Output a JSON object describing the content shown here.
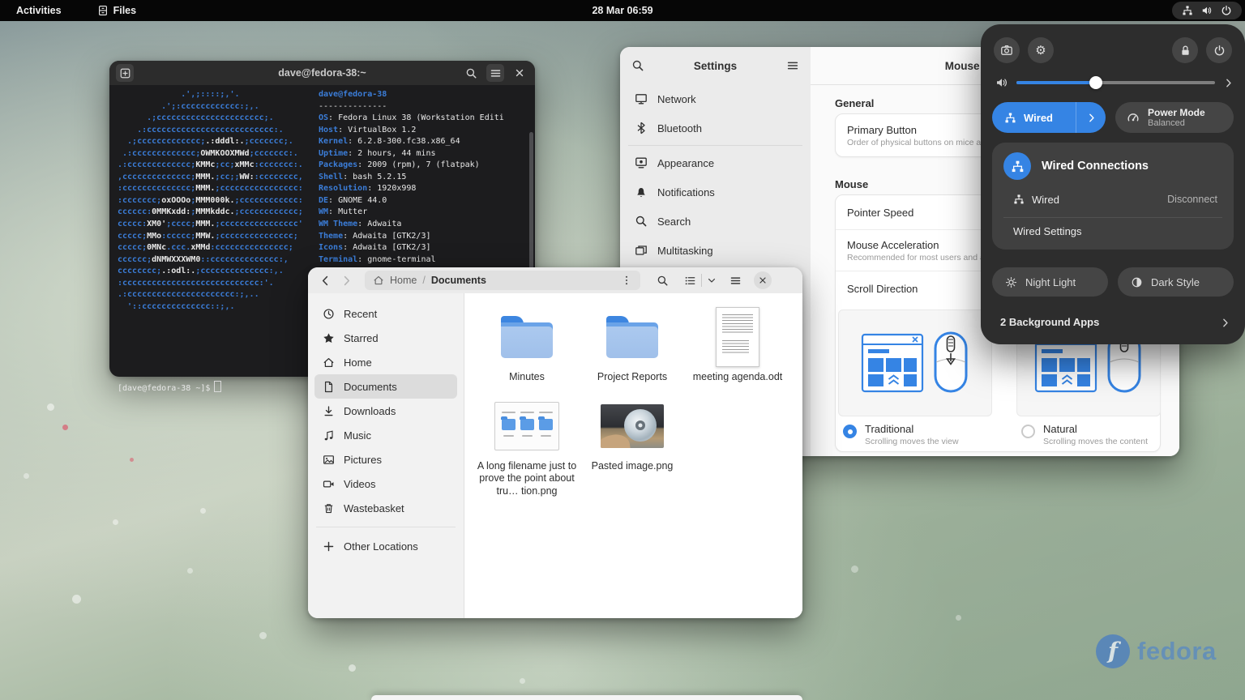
{
  "topbar": {
    "activities_label": "Activities",
    "app_name": "Files",
    "clock": "28 Mar 06:59"
  },
  "terminal": {
    "title": "dave@fedora-38:~",
    "user_host": "dave@fedora-38",
    "separator": "--------------",
    "prompt": "[dave@fedora-38 ~]$",
    "ascii_art": [
      [
        [
          "b",
          "             .',;::::;,'."
        ]
      ],
      [
        [
          "b",
          "         .';:cccccccccccc:;,."
        ]
      ],
      [
        [
          "b",
          "      .;cccccccccccccccccccccc;."
        ]
      ],
      [
        [
          "b",
          "    .:cccccccccccccccccccccccccc:."
        ]
      ],
      [
        [
          "b",
          "  .;ccccccccccccc;"
        ],
        [
          "w",
          ".:dddl:."
        ],
        [
          "b",
          ";ccccccc;."
        ]
      ],
      [
        [
          "b",
          " .:ccccccccccccc;"
        ],
        [
          "w",
          "OWMKOOXMWd"
        ],
        [
          "b",
          ";ccccccc:."
        ]
      ],
      [
        [
          "b",
          ".:ccccccccccccc;"
        ],
        [
          "w",
          "KMMc"
        ],
        [
          "b",
          ";cc;"
        ],
        [
          "w",
          "xMMc"
        ],
        [
          "b",
          ":ccccccc:."
        ]
      ],
      [
        [
          "b",
          ",cccccccccccccc;"
        ],
        [
          "w",
          "MMM."
        ],
        [
          "b",
          ";cc;;"
        ],
        [
          "w",
          "WW:"
        ],
        [
          "b",
          ":cccccccc,"
        ]
      ],
      [
        [
          "b",
          ":cccccccccccccc;"
        ],
        [
          "w",
          "MMM."
        ],
        [
          "b",
          ";cccccccccccccccc:"
        ]
      ],
      [
        [
          "b",
          ":ccccccc;"
        ],
        [
          "w",
          "oxOOOo"
        ],
        [
          "b",
          ";"
        ],
        [
          "w",
          "MMM000k."
        ],
        [
          "b",
          ";cccccccccccc:"
        ]
      ],
      [
        [
          "b",
          "cccccc:"
        ],
        [
          "w",
          "0MMKxdd:"
        ],
        [
          "b",
          ";"
        ],
        [
          "w",
          "MMMkddc."
        ],
        [
          "b",
          ";cccccccccccc;"
        ]
      ],
      [
        [
          "b",
          "ccccc:"
        ],
        [
          "w",
          "XM0'"
        ],
        [
          "b",
          ";cccc;"
        ],
        [
          "w",
          "MMM."
        ],
        [
          "b",
          ";cccccccccccccccc'"
        ]
      ],
      [
        [
          "b",
          "ccccc;"
        ],
        [
          "w",
          "MMo"
        ],
        [
          "b",
          ":ccccc;"
        ],
        [
          "w",
          "MMW."
        ],
        [
          "b",
          ";ccccccccccccccc;"
        ]
      ],
      [
        [
          "b",
          "ccccc;"
        ],
        [
          "w",
          "0MNc"
        ],
        [
          "b",
          ".ccc."
        ],
        [
          "w",
          "xMMd"
        ],
        [
          "b",
          ":ccccccccccccccc;"
        ]
      ],
      [
        [
          "b",
          "cccccc;"
        ],
        [
          "w",
          "dNMWXXXWM0"
        ],
        [
          "b",
          "::cccccccccccccc:,"
        ]
      ],
      [
        [
          "b",
          "cccccccc;"
        ],
        [
          "w",
          ".:odl:."
        ],
        [
          "b",
          ";cccccccccccccc:,."
        ]
      ],
      [
        [
          "b",
          ":cccccccccccccccccccccccccccc:'."
        ]
      ],
      [
        [
          "b",
          ".:cccccccccccccccccccccc:;,.."
        ]
      ],
      [
        [
          "b",
          "  '::cccccccccccccc::;,."
        ]
      ]
    ],
    "info": [
      {
        "label": "OS",
        "value": "Fedora Linux 38 (Workstation Editi"
      },
      {
        "label": "Host",
        "value": "VirtualBox 1.2"
      },
      {
        "label": "Kernel",
        "value": "6.2.8-300.fc38.x86_64"
      },
      {
        "label": "Uptime",
        "value": "2 hours, 44 mins"
      },
      {
        "label": "Packages",
        "value": "2009 (rpm), 7 (flatpak)"
      },
      {
        "label": "Shell",
        "value": "bash 5.2.15"
      },
      {
        "label": "Resolution",
        "value": "1920x998"
      },
      {
        "label": "DE",
        "value": "GNOME 44.0"
      },
      {
        "label": "WM",
        "value": "Mutter"
      },
      {
        "label": "WM Theme",
        "value": "Adwaita"
      },
      {
        "label": "Theme",
        "value": "Adwaita [GTK2/3]"
      },
      {
        "label": "Icons",
        "value": "Adwaita [GTK2/3]"
      },
      {
        "label": "Terminal",
        "value": "gnome-terminal"
      }
    ]
  },
  "settings": {
    "title": "Settings",
    "panel_title": "Mouse & Touchpad",
    "sidebar": [
      {
        "label": "Network",
        "icon": "monitor"
      },
      {
        "label": "Bluetooth",
        "icon": "bluetooth"
      },
      {
        "label": "Appearance",
        "icon": "appearance",
        "divider_before": true
      },
      {
        "label": "Notifications",
        "icon": "bell"
      },
      {
        "label": "Search",
        "icon": "magnifier"
      },
      {
        "label": "Multitasking",
        "icon": "multitask"
      }
    ],
    "general_heading": "General",
    "primary_button": {
      "title": "Primary Button",
      "subtitle": "Order of physical buttons on mice and touchpads."
    },
    "mouse_heading": "Mouse",
    "rows": {
      "pointer_speed": "Pointer Speed",
      "mouse_acceleration": {
        "title": "Mouse Acceleration",
        "subtitle": "Recommended for most users and applications"
      },
      "scroll_direction": "Scroll Direction"
    },
    "scroll_options": [
      {
        "label": "Traditional",
        "desc": "Scrolling moves the view",
        "selected": true
      },
      {
        "label": "Natural",
        "desc": "Scrolling moves the content",
        "selected": false
      }
    ]
  },
  "files": {
    "breadcrumb": {
      "root": "Home",
      "separator": "/",
      "current": "Documents"
    },
    "sidebar": [
      {
        "label": "Recent",
        "icon": "clock"
      },
      {
        "label": "Starred",
        "icon": "star"
      },
      {
        "label": "Home",
        "icon": "home"
      },
      {
        "label": "Documents",
        "icon": "doc",
        "selected": true
      },
      {
        "label": "Downloads",
        "icon": "download"
      },
      {
        "label": "Music",
        "icon": "music"
      },
      {
        "label": "Pictures",
        "icon": "picture"
      },
      {
        "label": "Videos",
        "icon": "video"
      },
      {
        "label": "Wastebasket",
        "icon": "trash"
      },
      {
        "label": "Other Locations",
        "icon": "plus",
        "divider_before": true
      }
    ],
    "items": [
      {
        "type": "folder",
        "label": "Minutes"
      },
      {
        "type": "folder",
        "label": "Project Reports"
      },
      {
        "type": "odt",
        "label": "meeting agenda.odt"
      },
      {
        "type": "screenshot",
        "label": "A long filename just to prove the point about tru…  tion.png"
      },
      {
        "type": "photo",
        "label": "Pasted image.png"
      }
    ]
  },
  "quick_settings": {
    "volume_percent": 40,
    "tiles": {
      "wired": "Wired",
      "power_mode_title": "Power Mode",
      "power_mode_subtitle": "Balanced",
      "night_light": "Night Light",
      "dark_style": "Dark Style"
    },
    "wired_connections": {
      "title": "Wired Connections",
      "row_label": "Wired",
      "row_action": "Disconnect",
      "settings_label": "Wired Settings"
    },
    "background_apps": "2 Background Apps"
  },
  "watermark": {
    "brand": "fedora"
  },
  "colors": {
    "accent_blue": "#3584e4",
    "terminal_blue": "#3b7dd8"
  }
}
